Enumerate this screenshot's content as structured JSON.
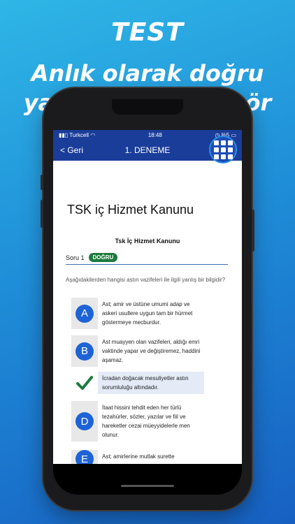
{
  "banner": {
    "title": "TEST",
    "line1": "Anlık olarak doğru",
    "line2": "yanlış cevapları gör"
  },
  "statusbar": {
    "carrier": "Turkcell",
    "time": "18:48",
    "battery": "%5"
  },
  "navbar": {
    "back_label": "< Geri",
    "title": "1. DENEME"
  },
  "content": {
    "title": "TSK iç Hizmet Kanunu",
    "subject": "Tsk İç Hizmet Kanunu",
    "question_label": "Soru 1",
    "result_badge": "DOĞRU",
    "question_text": "Aşağıdakilerden hangisi astın vazifeleri ile ilgili yanlış bir bilgidir?",
    "options": [
      {
        "letter": "A",
        "text": "Ast; amir ve üstüne umumi adap ve askeri usullere uygun tam bir hürmet göstermeye mecburdur."
      },
      {
        "letter": "B",
        "text": "Ast muayyen olan vazifeleri, aldığı emri vaktinde yapar ve değiştiremez, haddini aşamaz."
      },
      {
        "letter": "",
        "text": "İcradan doğacak mesuliyetler astın sorumluluğu altındadır."
      },
      {
        "letter": "D",
        "text": "İtaat hissini tehdit eden her türlü tezahürler, sözler, yazılar ve fiil ve hareketler cezai müeyyidelerle men olunur."
      },
      {
        "letter": "E",
        "text": "Ast; amirlerine mutlak surette"
      }
    ]
  },
  "colors": {
    "nav_blue": "#1a3d9a",
    "option_blue": "#1e63d6",
    "correct_green": "#1b7a3c"
  }
}
